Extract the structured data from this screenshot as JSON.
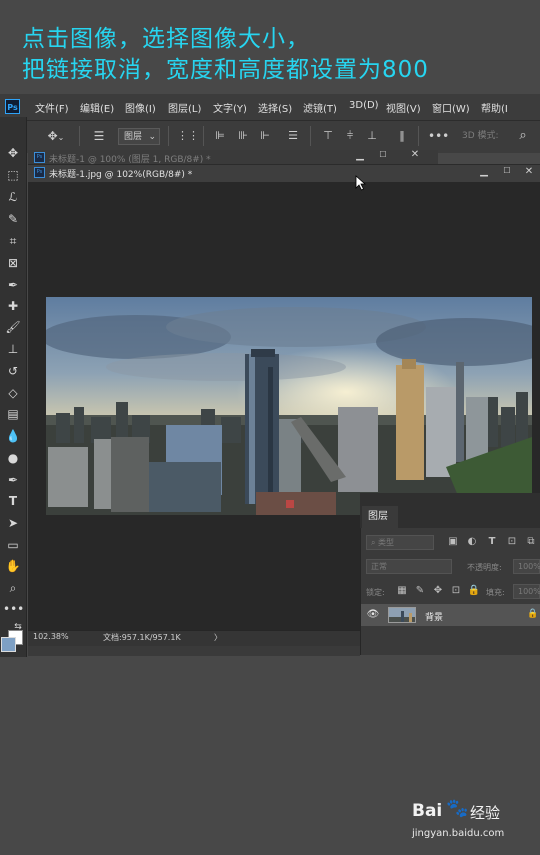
{
  "caption": {
    "line1": "点击图像，选择图像大小，",
    "line2": "把链接取消，宽度和高度都设置为800"
  },
  "app": {
    "logo_text": "Ps"
  },
  "menu": {
    "items": [
      "文件(F)",
      "编辑(E)",
      "图像(I)",
      "图层(L)",
      "文字(Y)",
      "选择(S)",
      "滤镜(T)",
      "3D(D)",
      "视图(V)",
      "窗口(W)",
      "帮助(I"
    ]
  },
  "options_bar": {
    "layer_select": "图层",
    "mode_3d": "3D 模式:"
  },
  "documents": {
    "tab_inactive": "未标题-1 @ 100% (图层 1, RGB/8#) *",
    "tab_active": "未标题-1.jpg @ 102%(RGB/8#) *"
  },
  "status": {
    "zoom": "102.38%",
    "doc_info": "文档:957.1K/957.1K",
    "arrow": "〉"
  },
  "layers_panel": {
    "title": "图层",
    "search_placeholder": "类型",
    "blend_mode": "正常",
    "opacity_label": "不透明度:",
    "opacity_value": "100%",
    "lock_label": "锁定:",
    "fill_label": "填充:",
    "fill_value": "100%",
    "layers": [
      {
        "name": "背景",
        "visible": true,
        "locked": true
      }
    ]
  },
  "watermark": {
    "brand": "Bai",
    "product": "经验",
    "url": "jingyan.baidu.com"
  },
  "colors": {
    "caption": "#27d5f0",
    "foreground": "#7ea0c4",
    "background": "#ffffff",
    "accent": "#2fa3f7"
  }
}
